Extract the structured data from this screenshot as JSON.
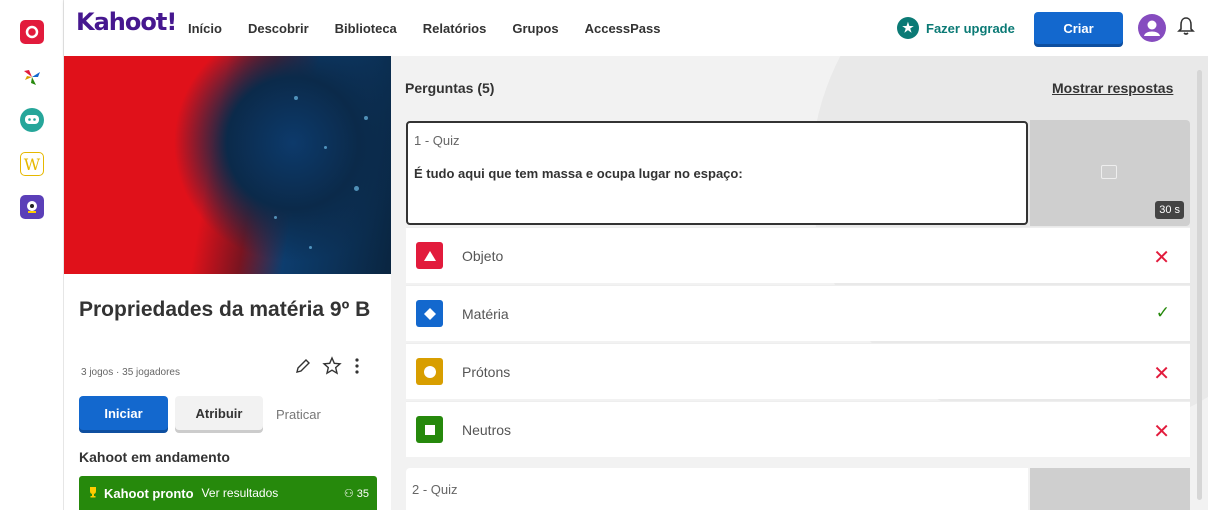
{
  "rail": {
    "apps": [
      {
        "name": "app-kahoot",
        "color": "#e21b3c"
      },
      {
        "name": "app-pinwheel",
        "color": "#ffffff"
      },
      {
        "name": "app-chat",
        "color": "#26890c"
      },
      {
        "name": "app-w",
        "color": "#d89e00"
      },
      {
        "name": "app-monster",
        "color": "#864cbf"
      }
    ],
    "w_letter": "W"
  },
  "header": {
    "logo": "Kahoot!",
    "nav": [
      "Início",
      "Descobrir",
      "Biblioteca",
      "Relatórios",
      "Grupos",
      "AccessPass"
    ],
    "upgrade_label": "Fazer upgrade",
    "create_label": "Criar"
  },
  "kahoot": {
    "title": "Propriedades da matéria 9º B",
    "meta": "3 jogos · 35 jogadores",
    "start_label": "Iniciar",
    "assign_label": "Atribuir",
    "practice_label": "Praticar",
    "in_progress_heading": "Kahoot em andamento",
    "ready_label": "Kahoot pronto",
    "results_label": "Ver resultados",
    "players_count": "35"
  },
  "questions": {
    "heading": "Perguntas (5)",
    "show_answers": "Mostrar respostas",
    "items": [
      {
        "label": "1 - Quiz",
        "text": "É tudo aqui que tem massa e ocupa lugar no espaço:",
        "time": "30 s",
        "answers": [
          {
            "text": "Objeto",
            "shape": "triangle",
            "color": "#e21b3c",
            "correct": false
          },
          {
            "text": "Matéria",
            "shape": "diamond",
            "color": "#1368ce",
            "correct": true
          },
          {
            "text": "Prótons",
            "shape": "circle",
            "color": "#d89e00",
            "correct": false
          },
          {
            "text": "Neutros",
            "shape": "square",
            "color": "#26890c",
            "correct": false
          }
        ]
      },
      {
        "label": "2 - Quiz"
      }
    ]
  },
  "colors": {
    "brand": "#46178f",
    "primary": "#1368ce",
    "teal": "#0b7a75",
    "correct": "#26890c",
    "wrong": "#e21b3c"
  }
}
